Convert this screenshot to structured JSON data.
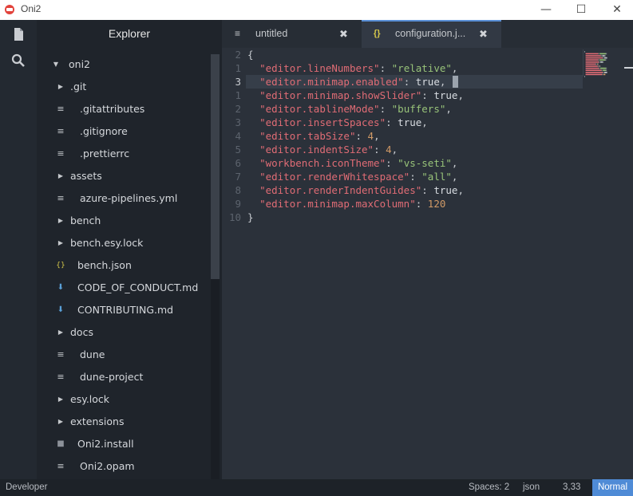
{
  "window": {
    "title": "Oni2",
    "minimize": "—",
    "maximize": "☐",
    "close": "✕"
  },
  "sidebar": {
    "header": "Explorer",
    "items": [
      {
        "label": "oni2",
        "kind": "folder-open",
        "level": 0
      },
      {
        "label": ".git",
        "kind": "folder",
        "level": 1
      },
      {
        "label": ".gitattributes",
        "kind": "file",
        "level": 1
      },
      {
        "label": ".gitignore",
        "kind": "file",
        "level": 1
      },
      {
        "label": ".prettierrc",
        "kind": "file",
        "level": 1
      },
      {
        "label": "assets",
        "kind": "folder",
        "level": 1
      },
      {
        "label": "azure-pipelines.yml",
        "kind": "file",
        "level": 1
      },
      {
        "label": "bench",
        "kind": "folder",
        "level": 1
      },
      {
        "label": "bench.esy.lock",
        "kind": "folder",
        "level": 1
      },
      {
        "label": "bench.json",
        "kind": "json",
        "level": 1
      },
      {
        "label": "CODE_OF_CONDUCT.md",
        "kind": "markdown",
        "level": 1
      },
      {
        "label": "CONTRIBUTING.md",
        "kind": "markdown",
        "level": 1
      },
      {
        "label": "docs",
        "kind": "folder",
        "level": 1
      },
      {
        "label": "dune",
        "kind": "file",
        "level": 1
      },
      {
        "label": "dune-project",
        "kind": "file",
        "level": 1
      },
      {
        "label": "esy.lock",
        "kind": "folder",
        "level": 1
      },
      {
        "label": "extensions",
        "kind": "folder",
        "level": 1
      },
      {
        "label": "Oni2.install",
        "kind": "binary",
        "level": 1
      },
      {
        "label": "Oni2.opam",
        "kind": "file",
        "level": 1
      }
    ]
  },
  "tabs": [
    {
      "label": "untitled",
      "icon": "lines-icon",
      "active": false
    },
    {
      "label": "configuration.j...",
      "icon": "json-icon",
      "active": true
    }
  ],
  "editor": {
    "line_numbers": [
      "2",
      "1",
      "3",
      "1",
      "2",
      "3",
      "4",
      "5",
      "6",
      "7",
      "8",
      "9",
      "10"
    ],
    "current_line_index": 2,
    "lines": [
      [
        {
          "t": "{",
          "c": "punc"
        }
      ],
      [
        {
          "t": "  ",
          "c": "punc"
        },
        {
          "t": "\"editor.lineNumbers\"",
          "c": "key"
        },
        {
          "t": ": ",
          "c": "punc"
        },
        {
          "t": "\"relative\"",
          "c": "str"
        },
        {
          "t": ",",
          "c": "punc"
        }
      ],
      [
        {
          "t": "  ",
          "c": "punc"
        },
        {
          "t": "\"editor.minimap.enabled\"",
          "c": "key"
        },
        {
          "t": ": ",
          "c": "punc"
        },
        {
          "t": "true",
          "c": "kw"
        },
        {
          "t": ",",
          "c": "punc"
        }
      ],
      [
        {
          "t": "  ",
          "c": "punc"
        },
        {
          "t": "\"editor.minimap.showSlider\"",
          "c": "key"
        },
        {
          "t": ": ",
          "c": "punc"
        },
        {
          "t": "true",
          "c": "kw"
        },
        {
          "t": ",",
          "c": "punc"
        }
      ],
      [
        {
          "t": "  ",
          "c": "punc"
        },
        {
          "t": "\"editor.tablineMode\"",
          "c": "key"
        },
        {
          "t": ": ",
          "c": "punc"
        },
        {
          "t": "\"buffers\"",
          "c": "str"
        },
        {
          "t": ",",
          "c": "punc"
        }
      ],
      [
        {
          "t": "  ",
          "c": "punc"
        },
        {
          "t": "\"editor.insertSpaces\"",
          "c": "key"
        },
        {
          "t": ": ",
          "c": "punc"
        },
        {
          "t": "true",
          "c": "kw"
        },
        {
          "t": ",",
          "c": "punc"
        }
      ],
      [
        {
          "t": "  ",
          "c": "punc"
        },
        {
          "t": "\"editor.tabSize\"",
          "c": "key"
        },
        {
          "t": ": ",
          "c": "punc"
        },
        {
          "t": "4",
          "c": "num"
        },
        {
          "t": ",",
          "c": "punc"
        }
      ],
      [
        {
          "t": "  ",
          "c": "punc"
        },
        {
          "t": "\"editor.indentSize\"",
          "c": "key"
        },
        {
          "t": ": ",
          "c": "punc"
        },
        {
          "t": "4",
          "c": "num"
        },
        {
          "t": ",",
          "c": "punc"
        }
      ],
      [
        {
          "t": "  ",
          "c": "punc"
        },
        {
          "t": "\"workbench.iconTheme\"",
          "c": "key"
        },
        {
          "t": ": ",
          "c": "punc"
        },
        {
          "t": "\"vs-seti\"",
          "c": "str"
        },
        {
          "t": ",",
          "c": "punc"
        }
      ],
      [
        {
          "t": "  ",
          "c": "punc"
        },
        {
          "t": "\"editor.renderWhitespace\"",
          "c": "key"
        },
        {
          "t": ": ",
          "c": "punc"
        },
        {
          "t": "\"all\"",
          "c": "str"
        },
        {
          "t": ",",
          "c": "punc"
        }
      ],
      [
        {
          "t": "  ",
          "c": "punc"
        },
        {
          "t": "\"editor.renderIndentGuides\"",
          "c": "key"
        },
        {
          "t": ": ",
          "c": "punc"
        },
        {
          "t": "true",
          "c": "kw"
        },
        {
          "t": ",",
          "c": "punc"
        }
      ],
      [
        {
          "t": "  ",
          "c": "punc"
        },
        {
          "t": "\"editor.minimap.maxColumn\"",
          "c": "key"
        },
        {
          "t": ": ",
          "c": "punc"
        },
        {
          "t": "120",
          "c": "num"
        }
      ],
      [
        {
          "t": "}",
          "c": "punc"
        }
      ]
    ]
  },
  "status": {
    "left": "Developer",
    "spaces": "Spaces: 2",
    "language": "json",
    "position": "3,33",
    "mode": "Normal"
  },
  "colors": {
    "accent": "#4f8bd6",
    "key": "#e06c75",
    "string": "#98c379",
    "number": "#d19a66"
  }
}
